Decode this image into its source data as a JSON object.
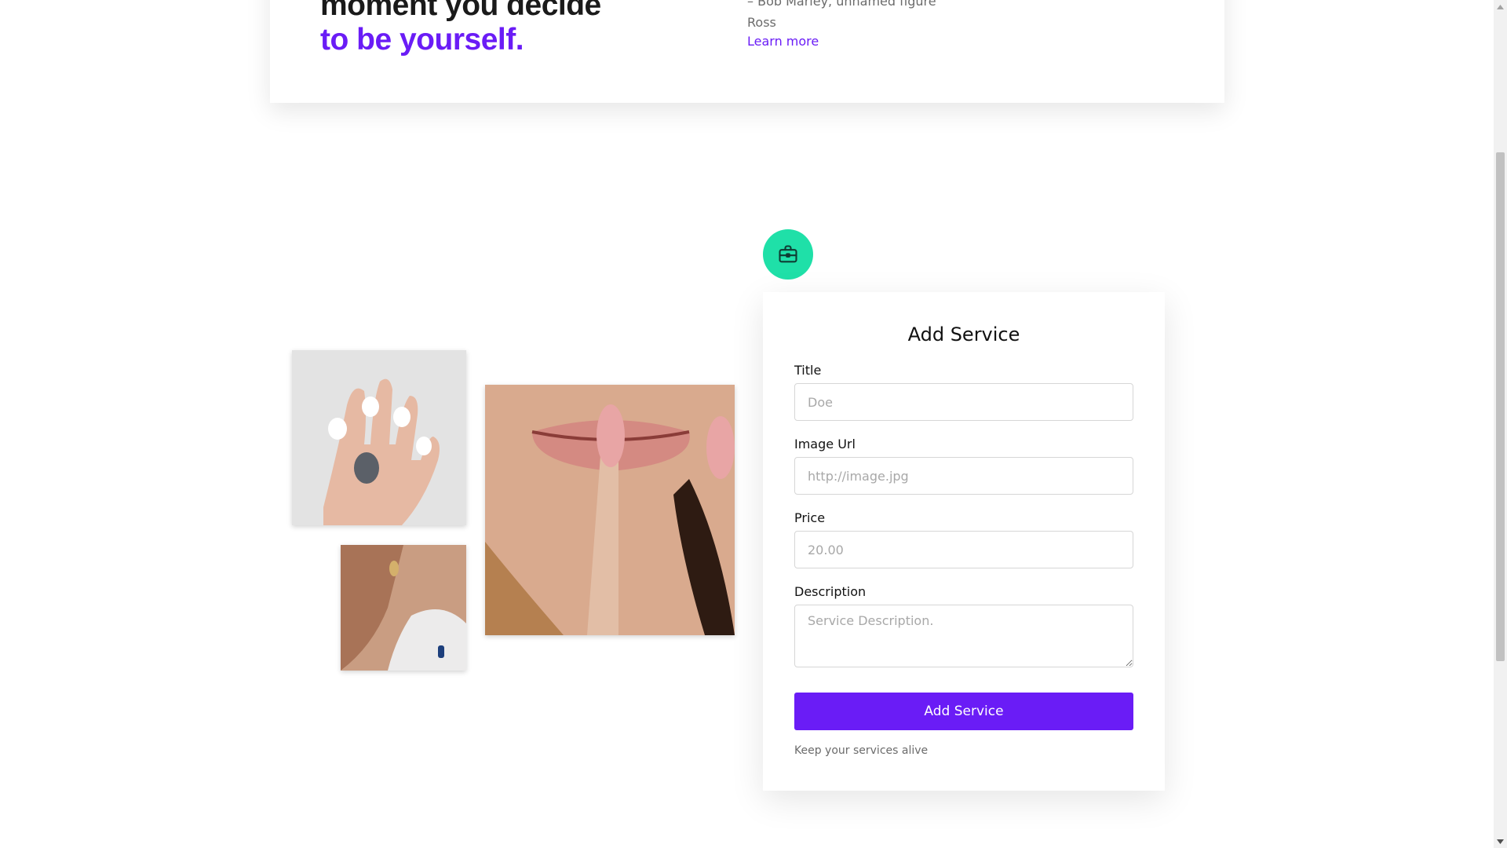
{
  "hero": {
    "headline_line1": "moment you decide",
    "headline_line2": "to be yourself.",
    "quote_line1": "– Bob Marley, unnamed figure",
    "quote_line2": "Ross",
    "learn_more": "Learn more"
  },
  "form": {
    "icon": "briefcase-icon",
    "title": "Add Service",
    "fields": {
      "title": {
        "label": "Title",
        "placeholder": "Doe"
      },
      "image_url": {
        "label": "Image Url",
        "placeholder": "http://image.jpg"
      },
      "price": {
        "label": "Price",
        "placeholder": "20.00"
      },
      "description": {
        "label": "Description",
        "placeholder": "Service Description."
      }
    },
    "submit_label": "Add Service",
    "note": "Keep your services alive"
  },
  "colors": {
    "accent": "#6a1cf6",
    "icon_bg": "#1fe0a8",
    "text": "#111111",
    "muted": "#6b6b6b"
  }
}
